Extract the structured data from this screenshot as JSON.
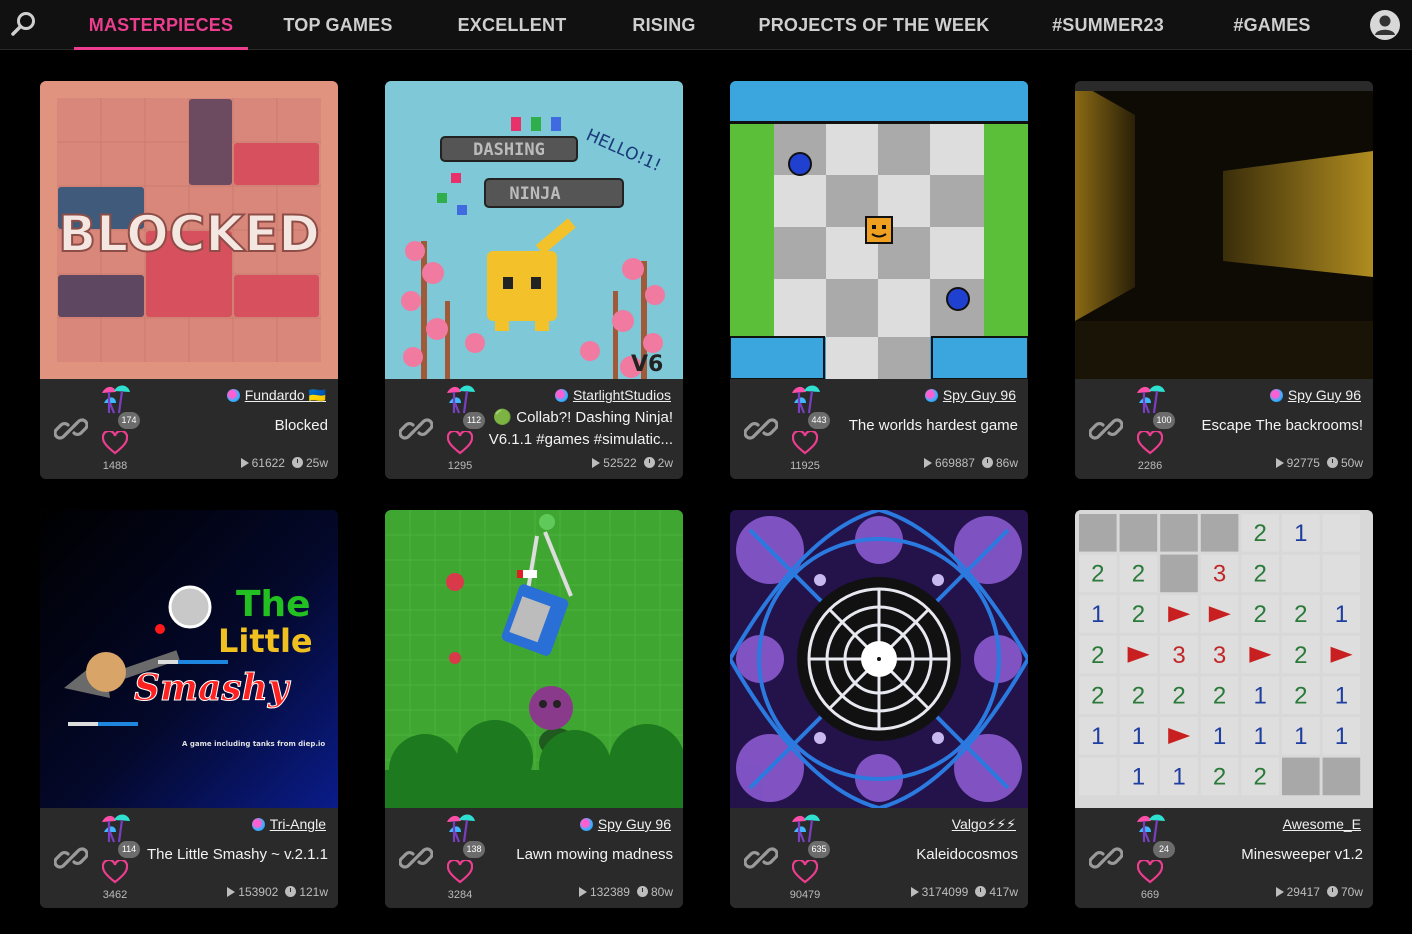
{
  "nav": {
    "tabs": [
      "MASTERPIECES",
      "TOP GAMES",
      "EXCELLENT",
      "RISING",
      "PROJECTS OF THE WEEK",
      "#SUMMER23",
      "#GAMES"
    ],
    "active_tab": "MASTERPIECES",
    "accent_color": "#ec3d8f",
    "icons": [
      "search-icon",
      "user-avatar-icon"
    ]
  },
  "cards": [
    {
      "author": "Fundardo 🇺🇦",
      "title": "Blocked",
      "badge": "174",
      "likes": "1488",
      "plays": "61622",
      "age": "25w",
      "thumb_text": "BLOCKED"
    },
    {
      "author": "StarlightStudios",
      "title": "🟢 Collab?! Dashing Ninja! V6.1.1 #games #simulatio...",
      "title_line1": "🟢 Collab?! Dashing Ninja!",
      "title_line2": "V6.1.1 #games #simulatic...",
      "badge": "112",
      "likes": "1295",
      "plays": "52522",
      "age": "2w",
      "thumb_text": [
        "DASHING",
        "NINJA",
        "HELLO!1!",
        "V6"
      ]
    },
    {
      "author": "Spy Guy 96",
      "title": "The worlds hardest game",
      "badge": "443",
      "likes": "11925",
      "plays": "669887",
      "age": "86w"
    },
    {
      "author": "Spy Guy 96",
      "title": "Escape The backrooms!",
      "badge": "100",
      "likes": "2286",
      "plays": "92775",
      "age": "50w"
    },
    {
      "author": "Tri-Angle",
      "title": "The Little Smashy ~ v.2.1.1",
      "badge": "114",
      "likes": "3462",
      "plays": "153902",
      "age": "121w",
      "thumb_text": [
        "The",
        "Little",
        "Smashy",
        "A game including tanks from diep.io"
      ]
    },
    {
      "author": "Spy Guy 96",
      "title": "Lawn mowing madness",
      "badge": "138",
      "likes": "3284",
      "plays": "132389",
      "age": "80w"
    },
    {
      "author": "Valgo⚡⚡⚡",
      "title": "Kaleidocosmos",
      "badge": "635",
      "likes": "90479",
      "plays": "3174099",
      "age": "417w"
    },
    {
      "author": "Awesome_E",
      "title": "Minesweeper v1.2",
      "badge": "24",
      "likes": "669",
      "plays": "29417",
      "age": "70w",
      "grid": [
        [
          "#",
          "#",
          "#",
          "#",
          "2",
          "1",
          ""
        ],
        [
          "2",
          "2",
          "#",
          "3",
          "2",
          "",
          ""
        ],
        [
          "1",
          "2",
          "F",
          "F",
          "2",
          "2",
          "1"
        ],
        [
          "2",
          "F",
          "3",
          "3",
          "F",
          "2",
          "F"
        ],
        [
          "2",
          "2",
          "2",
          "2",
          "1",
          "2",
          "1"
        ],
        [
          "1",
          "1",
          "F",
          "1",
          "1",
          "1",
          "1"
        ],
        [
          "",
          "1",
          "1",
          "2",
          "2",
          "#",
          "#"
        ]
      ]
    }
  ]
}
